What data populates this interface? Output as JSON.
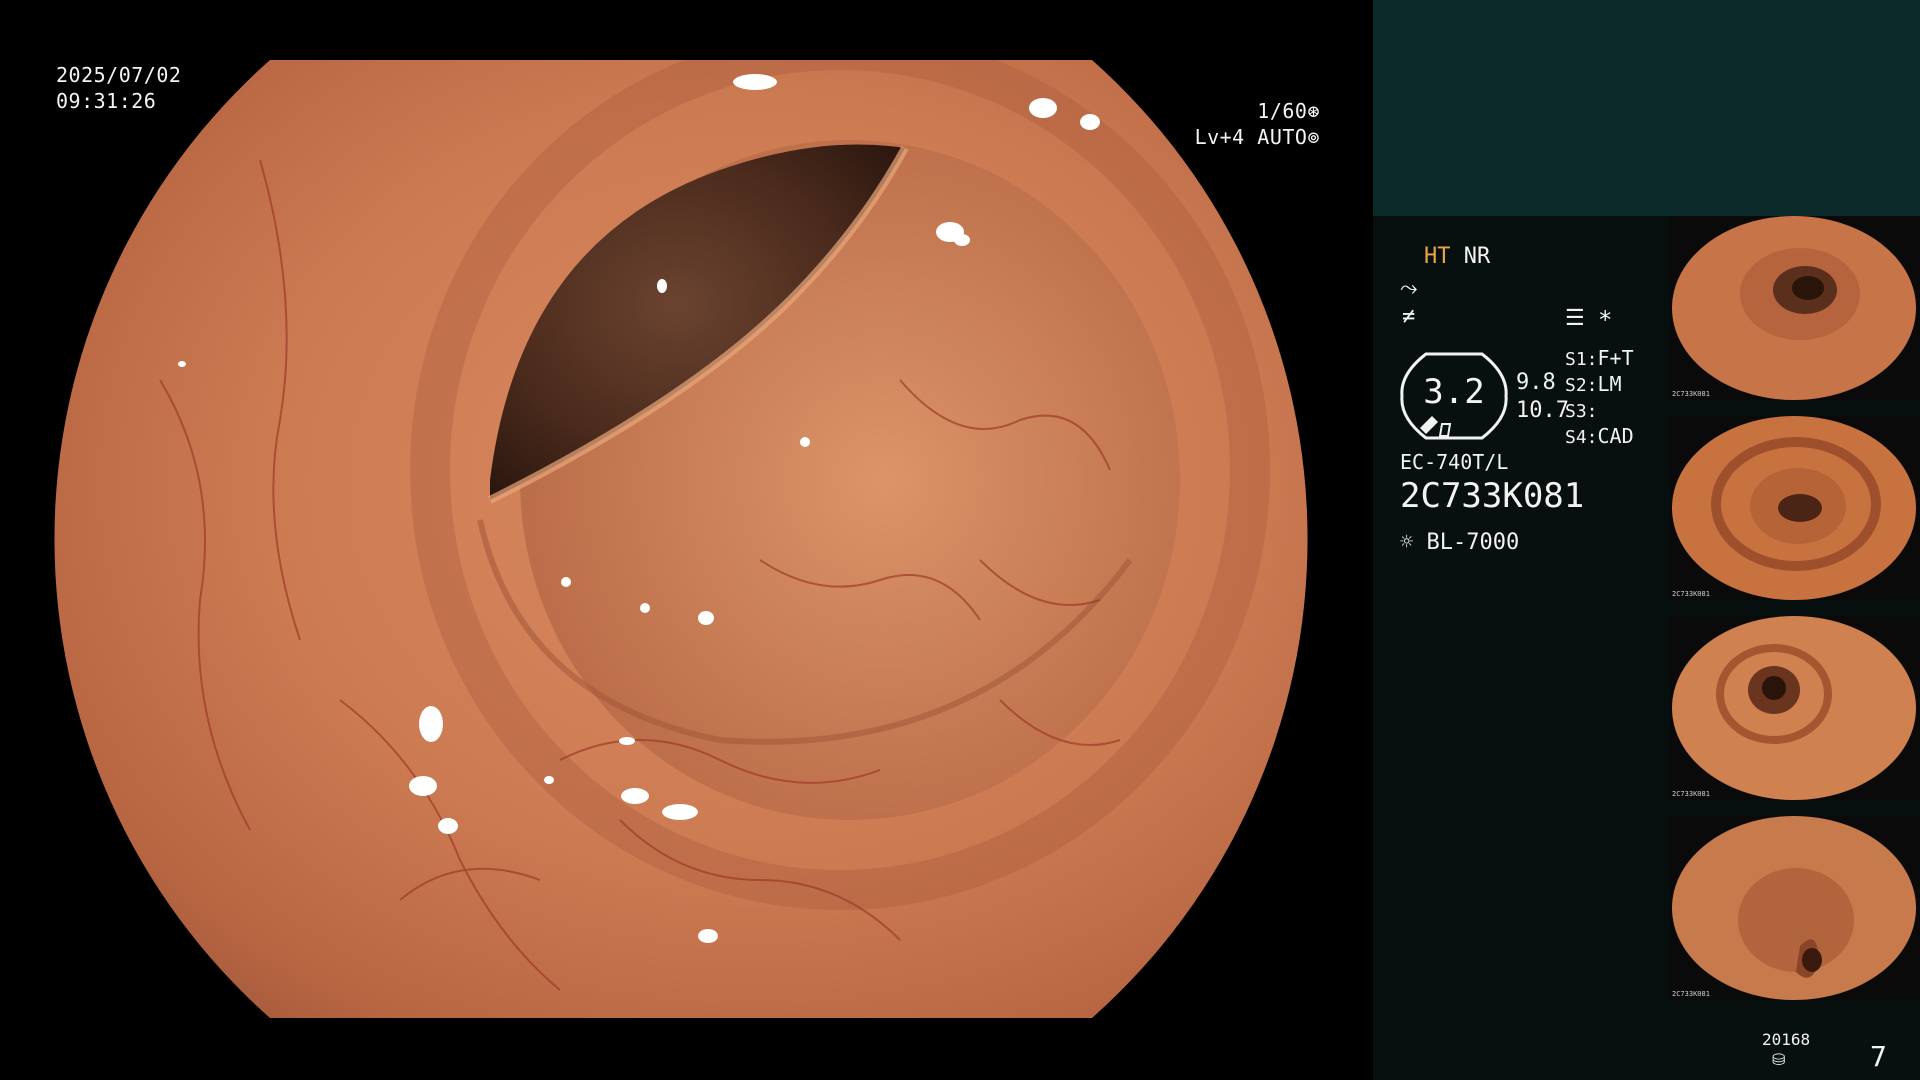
{
  "overlay": {
    "date": "2025/07/02",
    "time": "09:31:26",
    "shutter": "1/60",
    "level": "Lv+4",
    "iris_mode": "AUTO"
  },
  "panel": {
    "mode_ht": "HT",
    "mode_nr": "NR",
    "zoom_value": "3.2",
    "zoom_right_top": "9.8",
    "zoom_right_bottom": "10.7",
    "settings": [
      {
        "key": "S1:",
        "value": "F+T"
      },
      {
        "key": "S2:",
        "value": "LM"
      },
      {
        "key": "S3:",
        "value": ""
      },
      {
        "key": "S4:",
        "value": "CAD"
      }
    ],
    "asterisk": "*",
    "scope_model": "EC-740T/L",
    "serial": "2C733K081",
    "light_source": "BL-7000",
    "storage_count": "20168",
    "image_count": "7"
  },
  "thumbnails": [
    {
      "caption": "2C733K081"
    },
    {
      "caption": "2C733K081"
    },
    {
      "caption": "2C733K081"
    },
    {
      "caption": "2C733K081"
    }
  ],
  "colors": {
    "panel_bg": "#08100f",
    "panel_top_bg": "#0c2a2a",
    "ht_color": "#e6a64a",
    "mucosa": "#c9784f"
  }
}
